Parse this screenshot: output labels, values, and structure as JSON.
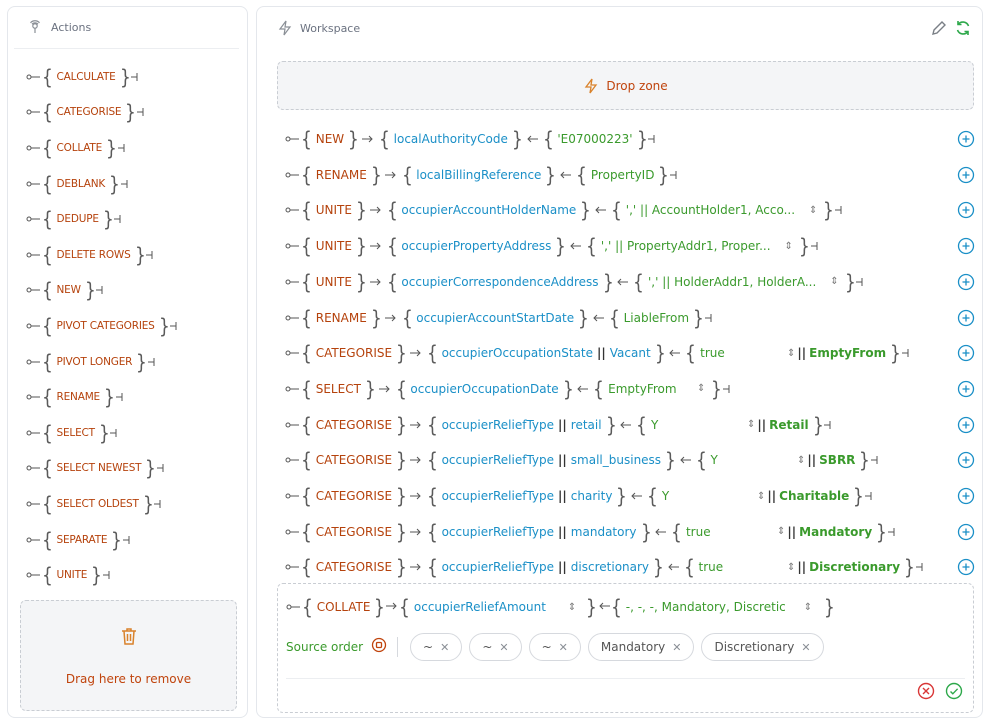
{
  "actions": {
    "title": "Actions",
    "items": [
      "CALCULATE",
      "CATEGORISE",
      "COLLATE",
      "DEBLANK",
      "DEDUPE",
      "DELETE ROWS",
      "NEW",
      "PIVOT CATEGORIES",
      "PIVOT LONGER",
      "RENAME",
      "SELECT",
      "SELECT NEWEST",
      "SELECT OLDEST",
      "SEPARATE",
      "UNITE"
    ],
    "remove_label": "Drag here to remove"
  },
  "workspace": {
    "title": "Workspace",
    "drop_label": "Drop zone",
    "rows": [
      {
        "op": "NEW",
        "field": "localAuthorityCode",
        "value": "'E07000223'",
        "extra": ""
      },
      {
        "op": "RENAME",
        "field": "localBillingReference",
        "value": "PropertyID",
        "extra": ""
      },
      {
        "op": "UNITE",
        "field": "occupierAccountHolderName",
        "value": "',' || AccountHolder1, Acco...",
        "extra": ""
      },
      {
        "op": "UNITE",
        "field": "occupierPropertyAddress",
        "value": "',' || PropertyAddr1, Proper...",
        "extra": ""
      },
      {
        "op": "UNITE",
        "field": "occupierCorrespondenceAddress",
        "value": "',' || HolderAddr1, HolderA...",
        "extra": ""
      },
      {
        "op": "RENAME",
        "field": "occupierAccountStartDate",
        "value": "LiableFrom",
        "extra": ""
      },
      {
        "op": "CATEGORISE",
        "field": "occupierOccupationState",
        "sub": "Vacant",
        "value": "true",
        "extra": "EmptyFrom"
      },
      {
        "op": "SELECT",
        "field": "occupierOccupationDate",
        "value": "EmptyFrom",
        "extra": ""
      },
      {
        "op": "CATEGORISE",
        "field": "occupierReliefType",
        "sub": "retail",
        "value": "Y",
        "extra": "Retail"
      },
      {
        "op": "CATEGORISE",
        "field": "occupierReliefType",
        "sub": "small_business",
        "value": "Y",
        "extra": "SBRR"
      },
      {
        "op": "CATEGORISE",
        "field": "occupierReliefType",
        "sub": "charity",
        "value": "Y",
        "extra": "Charitable"
      },
      {
        "op": "CATEGORISE",
        "field": "occupierReliefType",
        "sub": "mandatory",
        "value": "true",
        "extra": "Mandatory"
      },
      {
        "op": "CATEGORISE",
        "field": "occupierReliefType",
        "sub": "discretionary",
        "value": "true",
        "extra": "Discretionary"
      }
    ],
    "collate": {
      "op": "COLLATE",
      "field": "occupierReliefAmount",
      "value": "-, -, -, Mandatory, Discretic",
      "source_order_label": "Source order",
      "pills": [
        "~",
        "~",
        "~",
        "Mandatory",
        "Discretionary"
      ]
    }
  },
  "colors": {
    "op": "#b5420c",
    "field": "#1a8fc7",
    "value": "#3a9a2c",
    "accent": "#1a8fc7"
  }
}
